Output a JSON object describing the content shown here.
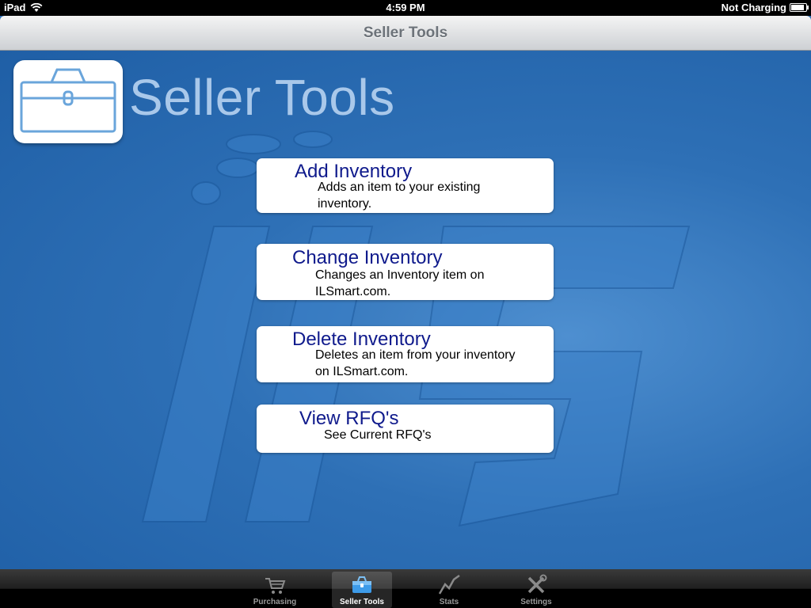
{
  "status_bar": {
    "device": "iPad",
    "time": "4:59 PM",
    "charging": "Not Charging"
  },
  "nav": {
    "title": "Seller Tools"
  },
  "header": {
    "title": "Seller Tools",
    "icon": "toolbox-icon"
  },
  "menu": [
    {
      "title": "Add Inventory",
      "desc": "Adds an item to your existing inventory."
    },
    {
      "title": "Change Inventory",
      "desc": "Changes an Inventory item on ILSmart.com."
    },
    {
      "title": "Delete Inventory",
      "desc": "Deletes an item from your inventory on ILSmart.com."
    },
    {
      "title": "View RFQ's",
      "desc": "See Current RFQ's"
    }
  ],
  "tabs": [
    {
      "label": "Purchasing",
      "icon": "cart-icon",
      "selected": false
    },
    {
      "label": "Seller Tools",
      "icon": "toolbox-icon",
      "selected": true
    },
    {
      "label": "Stats",
      "icon": "stats-icon",
      "selected": false
    },
    {
      "label": "Settings",
      "icon": "tools-icon",
      "selected": false
    }
  ],
  "colors": {
    "background": "#2f6fb3",
    "menu_title": "#0f1a8c",
    "header_text": "#a9c8ea"
  }
}
